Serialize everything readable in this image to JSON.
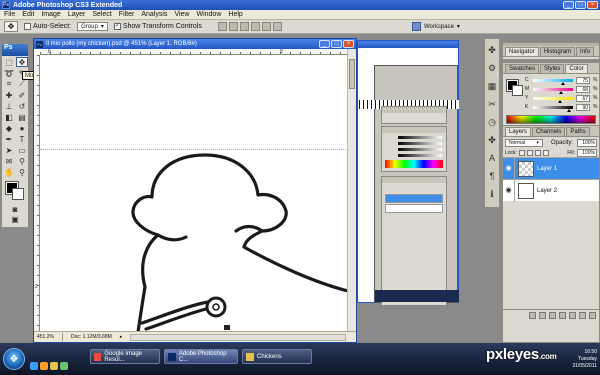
{
  "app": {
    "title": "Adobe Photoshop CS3 Extended",
    "ps_badge": "Ps"
  },
  "menu": [
    "File",
    "Edit",
    "Image",
    "Layer",
    "Select",
    "Filter",
    "Analysis",
    "View",
    "Window",
    "Help"
  ],
  "options_bar": {
    "auto_select_label": "Auto-Select:",
    "auto_select_value": "Group",
    "show_transform_label": "Show Transform Controls",
    "workspace_label": "Workspace"
  },
  "toolbox": {
    "tooltip": "Move Tool (V)",
    "tools": [
      "move",
      "marquee",
      "lasso",
      "quick-select",
      "crop",
      "slice",
      "heal",
      "brush",
      "stamp",
      "history-brush",
      "eraser",
      "gradient",
      "blur",
      "dodge",
      "pen",
      "type",
      "path-select",
      "shape",
      "notes",
      "eyedropper",
      "hand",
      "zoom"
    ]
  },
  "document": {
    "title": "Il mio pollo (my chicken).psd @ 451% (Layer 1, RGB/8#)",
    "zoom": "451.2%",
    "doc_info": "Doc: 1.12M/3.68M",
    "ruler_v_label": "2",
    "ruler_h_labels": [
      "6",
      "8"
    ]
  },
  "color_panel": {
    "tabs": [
      "Swatches",
      "Styles",
      "Color"
    ],
    "navigator_tabs": [
      "Navigator",
      "Histogram",
      "Info"
    ],
    "channels": [
      {
        "name": "C",
        "value": "75",
        "pct": "%"
      },
      {
        "name": "M",
        "value": "68",
        "pct": "%"
      },
      {
        "name": "Y",
        "value": "67",
        "pct": "%"
      },
      {
        "name": "K",
        "value": "90",
        "pct": "%"
      }
    ]
  },
  "layers_panel": {
    "tabs": [
      "Layers",
      "Channels",
      "Paths"
    ],
    "blend_mode": "Normal",
    "opacity_label": "Opacity:",
    "opacity": "100%",
    "lock_label": "Lock:",
    "fill_label": "Fill:",
    "fill": "100%",
    "layers": [
      {
        "name": "Layer 1",
        "selected": true
      },
      {
        "name": "Layer 2",
        "selected": false
      }
    ]
  },
  "taskbar": {
    "tasks": [
      {
        "label": "Google Image Resul...",
        "active": false
      },
      {
        "label": "Adobe Photoshop C...",
        "active": true
      },
      {
        "label": "Chickens",
        "active": false
      }
    ],
    "time": "16:50",
    "day": "Tuesday",
    "date": "31/05/2011"
  },
  "watermark": {
    "text": "pxleyes",
    "suffix": ".com"
  },
  "colors": {
    "titlebar": "#2457c5",
    "selected_layer": "#3d8ee8",
    "panel_bg": "#dcdad0"
  }
}
